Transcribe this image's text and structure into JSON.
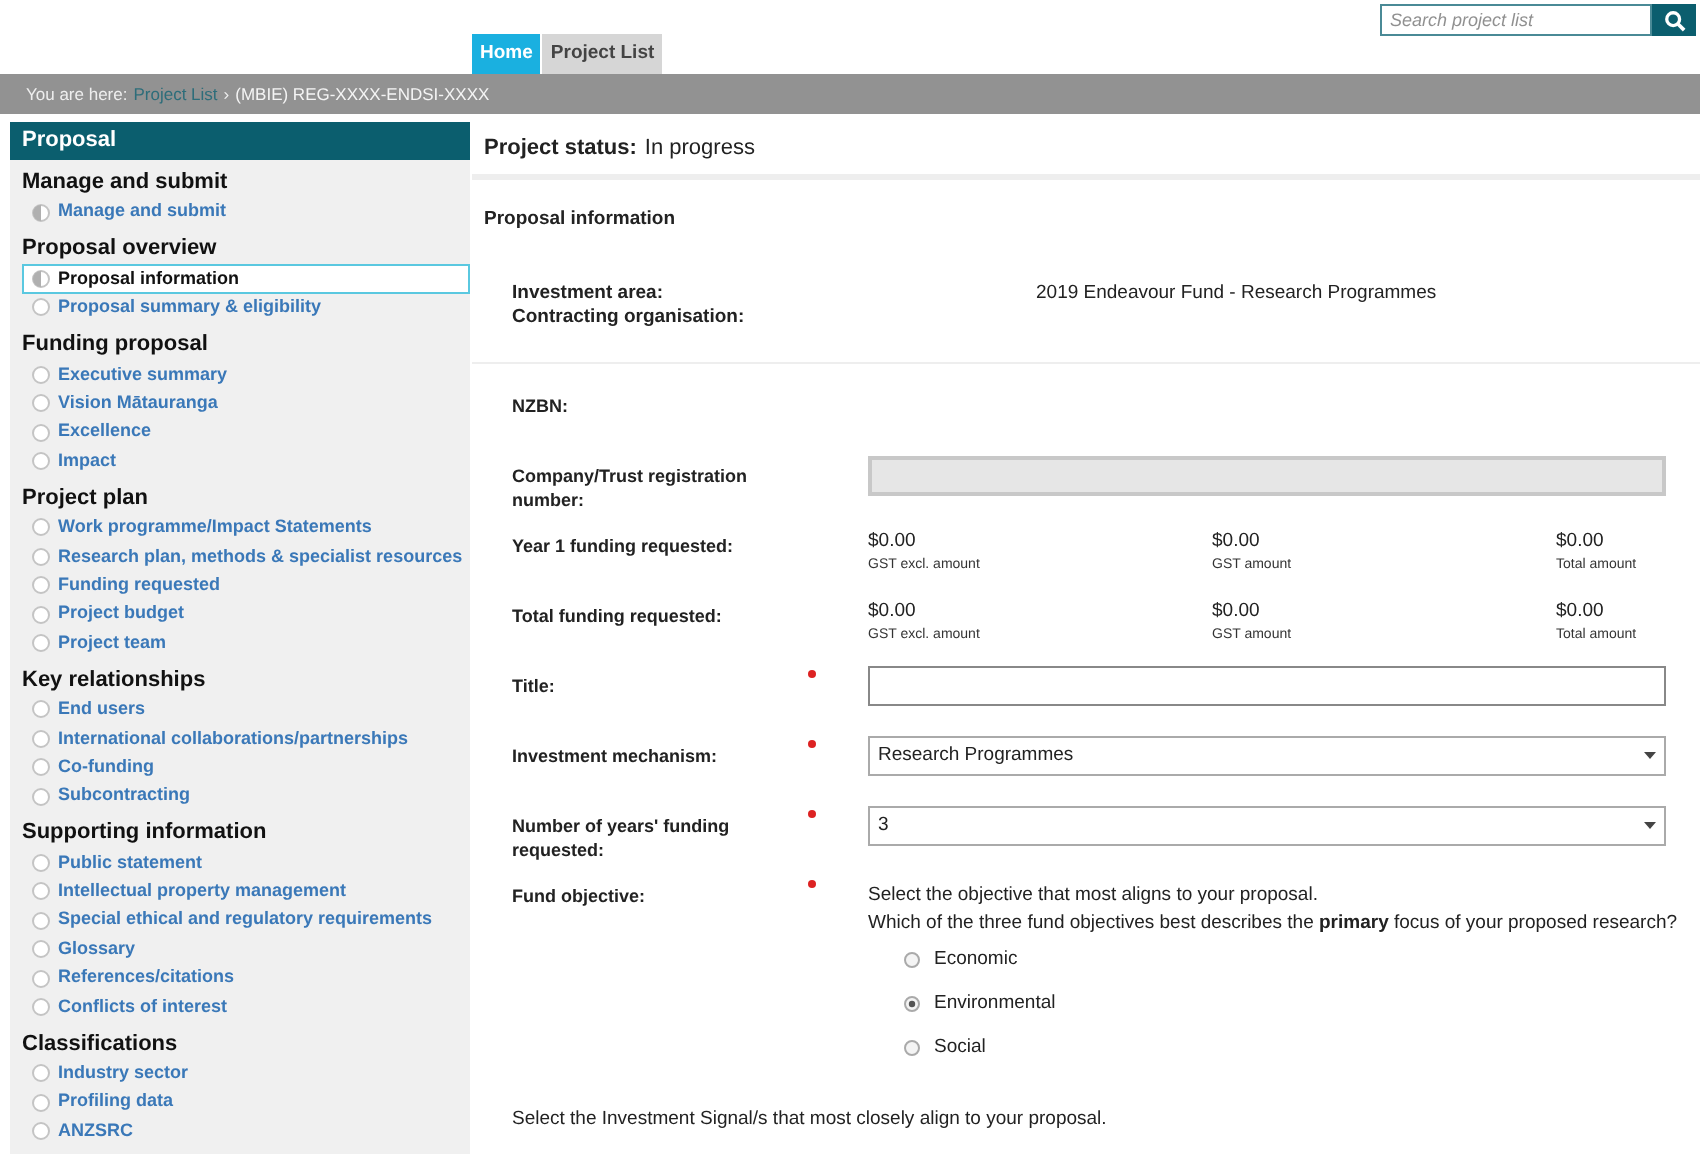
{
  "search": {
    "placeholder": "Search project list"
  },
  "tabs": [
    {
      "label": "Home",
      "selected": true
    },
    {
      "label": "Project List",
      "selected": false
    }
  ],
  "breadcrumb": {
    "prefix": "You are here:",
    "link": "Project List",
    "separator": "›",
    "current": "(MBIE) REG-XXXX-ENDSI-XXXX"
  },
  "sidebar": {
    "title": "Proposal",
    "groups": [
      {
        "heading": "Manage and submit",
        "items": [
          {
            "label": "Manage and submit",
            "selected": false,
            "in_progress": true
          }
        ]
      },
      {
        "heading": "Proposal overview",
        "items": [
          {
            "label": "Proposal information",
            "selected": true,
            "in_progress": true
          },
          {
            "label": "Proposal summary & eligibility",
            "selected": false,
            "in_progress": false
          }
        ]
      },
      {
        "heading": "Funding proposal",
        "items": [
          {
            "label": "Executive summary",
            "selected": false,
            "in_progress": false
          },
          {
            "label": "Vision Mātauranga",
            "selected": false,
            "in_progress": false
          },
          {
            "label": "Excellence",
            "selected": false,
            "in_progress": false
          },
          {
            "label": "Impact",
            "selected": false,
            "in_progress": false
          }
        ]
      },
      {
        "heading": "Project plan",
        "items": [
          {
            "label": "Work programme/Impact Statements",
            "selected": false,
            "in_progress": false
          },
          {
            "label": "Research plan, methods & specialist resources",
            "selected": false,
            "in_progress": false
          },
          {
            "label": "Funding requested",
            "selected": false,
            "in_progress": false
          },
          {
            "label": "Project budget",
            "selected": false,
            "in_progress": false
          },
          {
            "label": "Project team",
            "selected": false,
            "in_progress": false
          }
        ]
      },
      {
        "heading": "Key relationships",
        "items": [
          {
            "label": "End users",
            "selected": false,
            "in_progress": false
          },
          {
            "label": "International collaborations/partnerships",
            "selected": false,
            "in_progress": false
          },
          {
            "label": "Co-funding",
            "selected": false,
            "in_progress": false
          },
          {
            "label": "Subcontracting",
            "selected": false,
            "in_progress": false
          }
        ]
      },
      {
        "heading": "Supporting information",
        "items": [
          {
            "label": "Public statement",
            "selected": false,
            "in_progress": false
          },
          {
            "label": "Intellectual property management",
            "selected": false,
            "in_progress": false
          },
          {
            "label": "Special ethical and regulatory requirements",
            "selected": false,
            "in_progress": false
          },
          {
            "label": "Glossary",
            "selected": false,
            "in_progress": false
          },
          {
            "label": "References/citations",
            "selected": false,
            "in_progress": false
          },
          {
            "label": "Conflicts of interest",
            "selected": false,
            "in_progress": false
          }
        ]
      },
      {
        "heading": "Classifications",
        "items": [
          {
            "label": "Industry sector",
            "selected": false,
            "in_progress": false
          },
          {
            "label": "Profiling data",
            "selected": false,
            "in_progress": false
          },
          {
            "label": "ANZSRC",
            "selected": false,
            "in_progress": false
          }
        ]
      }
    ]
  },
  "status": {
    "label": "Project status:",
    "value": "In progress"
  },
  "section_title": "Proposal information",
  "info": {
    "labels": [
      "Investment area:",
      "Contracting organisation:"
    ],
    "value": "2019 Endeavour Fund - Research Programmes"
  },
  "fields": [
    {
      "kind": "plain",
      "label": "NZBN:",
      "required": false
    },
    {
      "kind": "input",
      "label": "Company/Trust registration number:",
      "required": false,
      "disabled": true
    },
    {
      "kind": "amounts",
      "label": "Year 1 funding requested:",
      "required": false,
      "amounts": [
        {
          "value": "$0.00",
          "caption": "GST excl. amount"
        },
        {
          "value": "$0.00",
          "caption": "GST amount"
        },
        {
          "value": "$0.00",
          "caption": "Total amount"
        }
      ]
    },
    {
      "kind": "amounts",
      "label": "Total funding requested:",
      "required": false,
      "amounts": [
        {
          "value": "$0.00",
          "caption": "GST excl. amount"
        },
        {
          "value": "$0.00",
          "caption": "GST amount"
        },
        {
          "value": "$0.00",
          "caption": "Total amount"
        }
      ]
    },
    {
      "kind": "input",
      "label": "Title:",
      "required": true,
      "disabled": false
    },
    {
      "kind": "select",
      "label": "Investment mechanism:",
      "required": true,
      "value": "Research Programmes"
    },
    {
      "kind": "select",
      "label": "Number of years' funding requested:",
      "required": true,
      "value": "3"
    },
    {
      "kind": "radio",
      "label": "Fund objective:",
      "required": true,
      "prompts": [
        "Select the objective that most aligns to your proposal.",
        "Which of the three fund objectives best describes the **primary** focus of your proposed research?"
      ],
      "options": [
        {
          "label": "Economic",
          "selected": false
        },
        {
          "label": "Environmental",
          "selected": true
        },
        {
          "label": "Social",
          "selected": false
        }
      ]
    }
  ],
  "signals_prompt": "Select the Investment Signal/s that most closely align to your proposal."
}
